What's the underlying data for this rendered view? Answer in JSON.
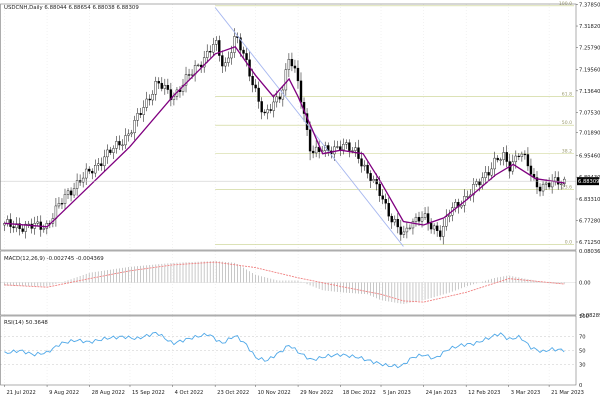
{
  "header": {
    "main": "USDCNH,Daily  6.88044 6.88654 6.88038 6.88309",
    "macd": "MACD(12,26,9) -0.002745 -0.004369",
    "rsi": "RSI(14) 50.3648"
  },
  "colors": {
    "background": "#ffffff",
    "bull_candle": "#ffffff",
    "bear_candle": "#000000",
    "moving_average": "#800080",
    "trend_line": "#a8b8f0",
    "fib_lines": "#c8d08a",
    "macd_histogram": "#b0b0b0",
    "macd_signal": "#f08080",
    "rsi_line": "#4fa8e8",
    "grid": "#e6e6e6"
  },
  "chart_data": [
    {
      "type": "candlestick",
      "title": "USDCNH,Daily",
      "ohlc_last": {
        "open": 6.88044,
        "high": 6.88654,
        "low": 6.88038,
        "close": 6.88309
      },
      "y_ticks": [
        "7.37850",
        "7.31820",
        "7.25790",
        "7.19560",
        "7.13640",
        "7.07530",
        "7.01890",
        "6.95460",
        "6.89430",
        "6.83310",
        "6.77280",
        "6.71250"
      ],
      "ylim": [
        6.69,
        7.38
      ],
      "last_price_label": "6.88309",
      "x_ticks": [
        "21 Jul 2022",
        "9 Aug 2022",
        "28 Aug 2022",
        "15 Sep 2022",
        "4 Oct 2022",
        "23 Oct 2022",
        "10 Nov 2022",
        "29 Nov 2022",
        "18 Dec 2022",
        "5 Jan 2023",
        "24 Jan 2023",
        "12 Feb 2023",
        "3 Mar 2023",
        "21 Mar 2023"
      ],
      "x_dates": [
        "2022-07-21",
        "2022-08-09",
        "2022-08-28",
        "2022-09-15",
        "2022-10-04",
        "2022-10-23",
        "2022-11-10",
        "2022-11-29",
        "2022-12-18",
        "2023-01-05",
        "2023-01-24",
        "2023-02-12",
        "2023-03-03",
        "2023-03-21"
      ],
      "close_path": [
        {
          "date": "2022-07-21",
          "close": 6.76
        },
        {
          "date": "2022-08-01",
          "close": 6.755
        },
        {
          "date": "2022-08-09",
          "close": 6.76
        },
        {
          "date": "2022-08-18",
          "close": 6.85
        },
        {
          "date": "2022-08-28",
          "close": 6.91
        },
        {
          "date": "2022-09-07",
          "close": 6.97
        },
        {
          "date": "2022-09-15",
          "close": 7.02
        },
        {
          "date": "2022-09-27",
          "close": 7.16
        },
        {
          "date": "2022-10-04",
          "close": 7.12
        },
        {
          "date": "2022-10-13",
          "close": 7.19
        },
        {
          "date": "2022-10-23",
          "close": 7.27
        },
        {
          "date": "2022-10-27",
          "close": 7.2
        },
        {
          "date": "2022-11-01",
          "close": 7.29
        },
        {
          "date": "2022-11-05",
          "close": 7.23
        },
        {
          "date": "2022-11-10",
          "close": 7.14
        },
        {
          "date": "2022-11-14",
          "close": 7.06
        },
        {
          "date": "2022-11-22",
          "close": 7.14
        },
        {
          "date": "2022-11-25",
          "close": 7.23
        },
        {
          "date": "2022-11-29",
          "close": 7.16
        },
        {
          "date": "2022-12-05",
          "close": 6.96
        },
        {
          "date": "2022-12-10",
          "close": 6.97
        },
        {
          "date": "2022-12-18",
          "close": 6.98
        },
        {
          "date": "2022-12-25",
          "close": 6.97
        },
        {
          "date": "2022-12-30",
          "close": 6.9
        },
        {
          "date": "2023-01-05",
          "close": 6.85
        },
        {
          "date": "2023-01-10",
          "close": 6.77
        },
        {
          "date": "2023-01-15",
          "close": 6.73
        },
        {
          "date": "2023-01-18",
          "close": 6.77
        },
        {
          "date": "2023-01-24",
          "close": 6.78
        },
        {
          "date": "2023-01-27",
          "close": 6.76
        },
        {
          "date": "2023-02-01",
          "close": 6.74
        },
        {
          "date": "2023-02-05",
          "close": 6.8
        },
        {
          "date": "2023-02-12",
          "close": 6.84
        },
        {
          "date": "2023-02-18",
          "close": 6.88
        },
        {
          "date": "2023-02-25",
          "close": 6.94
        },
        {
          "date": "2023-03-01",
          "close": 6.95
        },
        {
          "date": "2023-03-03",
          "close": 6.92
        },
        {
          "date": "2023-03-08",
          "close": 6.97
        },
        {
          "date": "2023-03-12",
          "close": 6.92
        },
        {
          "date": "2023-03-15",
          "close": 6.87
        },
        {
          "date": "2023-03-21",
          "close": 6.875
        },
        {
          "date": "2023-03-28",
          "close": 6.883
        }
      ],
      "moving_average_path": [
        {
          "date": "2022-07-21",
          "value": 6.765
        },
        {
          "date": "2022-08-09",
          "value": 6.755
        },
        {
          "date": "2022-08-28",
          "value": 6.87
        },
        {
          "date": "2022-09-15",
          "value": 6.98
        },
        {
          "date": "2022-10-04",
          "value": 7.12
        },
        {
          "date": "2022-10-23",
          "value": 7.24
        },
        {
          "date": "2022-11-01",
          "value": 7.26
        },
        {
          "date": "2022-11-10",
          "value": 7.18
        },
        {
          "date": "2022-11-18",
          "value": 7.12
        },
        {
          "date": "2022-11-25",
          "value": 7.17
        },
        {
          "date": "2022-11-29",
          "value": 7.12
        },
        {
          "date": "2022-12-10",
          "value": 6.96
        },
        {
          "date": "2022-12-18",
          "value": 6.97
        },
        {
          "date": "2022-12-28",
          "value": 6.96
        },
        {
          "date": "2023-01-05",
          "value": 6.88
        },
        {
          "date": "2023-01-15",
          "value": 6.77
        },
        {
          "date": "2023-01-24",
          "value": 6.76
        },
        {
          "date": "2023-02-02",
          "value": 6.78
        },
        {
          "date": "2023-02-12",
          "value": 6.83
        },
        {
          "date": "2023-02-25",
          "value": 6.9
        },
        {
          "date": "2023-03-05",
          "value": 6.93
        },
        {
          "date": "2023-03-15",
          "value": 6.89
        },
        {
          "date": "2023-03-28",
          "value": 6.878
        }
      ],
      "trend_line": [
        {
          "date": "2022-10-23",
          "value": 7.37
        },
        {
          "date": "2023-01-15",
          "value": 6.7
        }
      ],
      "fib_level_labels": [
        "100.0",
        "61.8",
        "50.0",
        "38.2",
        "23.6",
        "0.0"
      ],
      "fib_level_values": [
        7.375,
        7.12,
        7.04,
        6.96,
        6.86,
        6.705
      ]
    },
    {
      "type": "bar",
      "title": "MACD(12,26,9)",
      "value_main": -0.002745,
      "value_signal": -0.004369,
      "y_ticks": [
        "0.080364",
        "0.00",
        "-0.082897"
      ],
      "ylim": [
        -0.0829,
        0.0804
      ],
      "histogram": [
        {
          "date": "2022-07-21",
          "value": -0.008
        },
        {
          "date": "2022-08-09",
          "value": -0.01
        },
        {
          "date": "2022-08-18",
          "value": 0.005
        },
        {
          "date": "2022-08-28",
          "value": 0.025
        },
        {
          "date": "2022-09-15",
          "value": 0.04
        },
        {
          "date": "2022-10-04",
          "value": 0.05
        },
        {
          "date": "2022-10-23",
          "value": 0.055
        },
        {
          "date": "2022-11-01",
          "value": 0.05
        },
        {
          "date": "2022-11-10",
          "value": 0.02
        },
        {
          "date": "2022-11-20",
          "value": 0.005
        },
        {
          "date": "2022-11-29",
          "value": 0.005
        },
        {
          "date": "2022-12-10",
          "value": -0.02
        },
        {
          "date": "2022-12-18",
          "value": -0.025
        },
        {
          "date": "2022-12-30",
          "value": -0.03
        },
        {
          "date": "2023-01-05",
          "value": -0.045
        },
        {
          "date": "2023-01-15",
          "value": -0.055
        },
        {
          "date": "2023-01-24",
          "value": -0.045
        },
        {
          "date": "2023-02-05",
          "value": -0.025
        },
        {
          "date": "2023-02-12",
          "value": -0.01
        },
        {
          "date": "2023-02-25",
          "value": 0.012
        },
        {
          "date": "2023-03-03",
          "value": 0.018
        },
        {
          "date": "2023-03-12",
          "value": 0.008
        },
        {
          "date": "2023-03-21",
          "value": -0.002
        },
        {
          "date": "2023-03-28",
          "value": -0.003
        }
      ],
      "signal": [
        {
          "date": "2022-07-21",
          "value": -0.006
        },
        {
          "date": "2022-08-09",
          "value": -0.012
        },
        {
          "date": "2022-08-28",
          "value": 0.01
        },
        {
          "date": "2022-09-15",
          "value": 0.03
        },
        {
          "date": "2022-10-04",
          "value": 0.045
        },
        {
          "date": "2022-10-23",
          "value": 0.052
        },
        {
          "date": "2022-11-10",
          "value": 0.038
        },
        {
          "date": "2022-11-29",
          "value": 0.012
        },
        {
          "date": "2022-12-18",
          "value": -0.01
        },
        {
          "date": "2023-01-05",
          "value": -0.03
        },
        {
          "date": "2023-01-15",
          "value": -0.047
        },
        {
          "date": "2023-01-24",
          "value": -0.05
        },
        {
          "date": "2023-02-12",
          "value": -0.025
        },
        {
          "date": "2023-03-03",
          "value": 0.01
        },
        {
          "date": "2023-03-21",
          "value": 0.0
        },
        {
          "date": "2023-03-28",
          "value": -0.004
        }
      ]
    },
    {
      "type": "line",
      "title": "RSI(14)",
      "value": 50.3648,
      "y_ticks": [
        "100",
        "70",
        "50",
        "30",
        "0"
      ],
      "ylim": [
        0,
        100
      ],
      "values": [
        {
          "date": "2022-07-21",
          "value": 46
        },
        {
          "date": "2022-07-28",
          "value": 50
        },
        {
          "date": "2022-08-03",
          "value": 44
        },
        {
          "date": "2022-08-09",
          "value": 47
        },
        {
          "date": "2022-08-15",
          "value": 60
        },
        {
          "date": "2022-08-22",
          "value": 65
        },
        {
          "date": "2022-08-28",
          "value": 62
        },
        {
          "date": "2022-09-05",
          "value": 68
        },
        {
          "date": "2022-09-12",
          "value": 70
        },
        {
          "date": "2022-09-18",
          "value": 67
        },
        {
          "date": "2022-09-27",
          "value": 76
        },
        {
          "date": "2022-10-04",
          "value": 60
        },
        {
          "date": "2022-10-12",
          "value": 68
        },
        {
          "date": "2022-10-20",
          "value": 74
        },
        {
          "date": "2022-10-26",
          "value": 60
        },
        {
          "date": "2022-11-01",
          "value": 72
        },
        {
          "date": "2022-11-06",
          "value": 58
        },
        {
          "date": "2022-11-10",
          "value": 40
        },
        {
          "date": "2022-11-15",
          "value": 35
        },
        {
          "date": "2022-11-22",
          "value": 50
        },
        {
          "date": "2022-11-25",
          "value": 58
        },
        {
          "date": "2022-11-29",
          "value": 48
        },
        {
          "date": "2022-12-05",
          "value": 36
        },
        {
          "date": "2022-12-12",
          "value": 42
        },
        {
          "date": "2022-12-18",
          "value": 44
        },
        {
          "date": "2022-12-26",
          "value": 40
        },
        {
          "date": "2023-01-02",
          "value": 33
        },
        {
          "date": "2023-01-08",
          "value": 28
        },
        {
          "date": "2023-01-14",
          "value": 27
        },
        {
          "date": "2023-01-19",
          "value": 40
        },
        {
          "date": "2023-01-24",
          "value": 44
        },
        {
          "date": "2023-01-29",
          "value": 38
        },
        {
          "date": "2023-02-04",
          "value": 52
        },
        {
          "date": "2023-02-10",
          "value": 58
        },
        {
          "date": "2023-02-16",
          "value": 60
        },
        {
          "date": "2023-02-22",
          "value": 68
        },
        {
          "date": "2023-02-27",
          "value": 75
        },
        {
          "date": "2023-03-03",
          "value": 66
        },
        {
          "date": "2023-03-08",
          "value": 70
        },
        {
          "date": "2023-03-13",
          "value": 54
        },
        {
          "date": "2023-03-18",
          "value": 48
        },
        {
          "date": "2023-03-22",
          "value": 52
        },
        {
          "date": "2023-03-28",
          "value": 50.36
        }
      ]
    }
  ]
}
